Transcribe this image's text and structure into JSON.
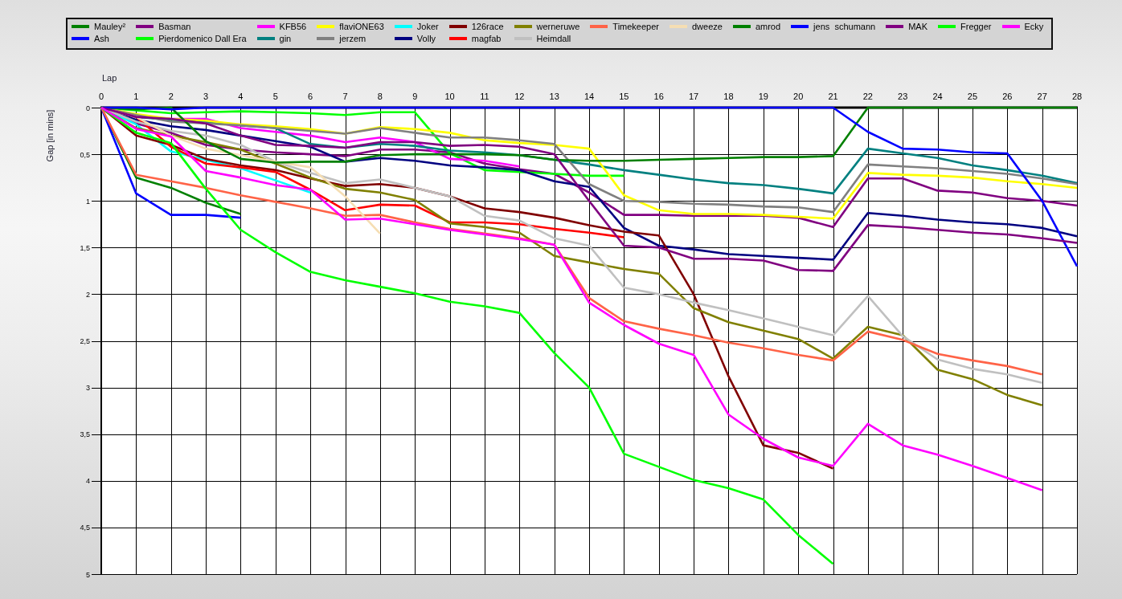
{
  "chart": {
    "chart_data": {
      "type": "line",
      "xlabel": "Lap",
      "ylabel": "Gap [in mins]",
      "grid": true,
      "x": [
        0,
        1,
        2,
        3,
        4,
        5,
        6,
        7,
        8,
        9,
        10,
        11,
        12,
        13,
        14,
        15,
        16,
        17,
        18,
        19,
        20,
        21,
        22,
        23,
        24,
        25,
        26,
        27,
        28
      ],
      "xlim": [
        0,
        28
      ],
      "ylim": [
        5,
        0
      ],
      "xticks": [
        0,
        1,
        2,
        3,
        4,
        5,
        6,
        7,
        8,
        9,
        10,
        11,
        12,
        13,
        14,
        15,
        16,
        17,
        18,
        19,
        20,
        21,
        22,
        23,
        24,
        25,
        26,
        27,
        28
      ],
      "yticks": [
        0,
        {
          "value": 0.5,
          "label": "0,5"
        },
        1,
        {
          "value": 1.5,
          "label": "1,5"
        },
        2,
        {
          "value": 2.5,
          "label": "2,5"
        },
        3,
        {
          "value": 3.5,
          "label": "3,5"
        },
        4,
        {
          "value": 4.5,
          "label": "4,5"
        },
        5
      ],
      "series": [
        {
          "name": "Mauley²",
          "color": "#008000",
          "values": [
            0,
            0.75,
            0.86,
            1.02,
            1.14,
            null,
            null,
            null,
            null,
            null,
            null,
            null,
            null,
            null,
            null,
            null,
            null,
            null,
            null,
            null,
            null,
            null,
            null,
            null,
            null,
            null,
            null,
            null,
            null
          ]
        },
        {
          "name": "Ash",
          "color": "#0000ff",
          "values": [
            0,
            0.92,
            1.15,
            1.15,
            1.18,
            null,
            null,
            null,
            null,
            null,
            null,
            null,
            null,
            null,
            null,
            null,
            null,
            null,
            null,
            null,
            null,
            null,
            null,
            null,
            null,
            null,
            null,
            null,
            null
          ]
        },
        {
          "name": "Basman",
          "color": "#800080",
          "values": [
            0,
            0.17,
            0.27,
            0.4,
            0.45,
            0.48,
            0.5,
            0.52,
            0.45,
            0.45,
            0.48,
            0.6,
            0.66,
            0.71,
            0.91,
            1.15,
            1.15,
            1.16,
            1.16,
            1.16,
            1.18,
            1.28,
            0.76,
            0.76,
            0.89,
            0.91,
            0.97,
            1.0,
            1.05
          ]
        },
        {
          "name": "Pierdomenico Dall Era",
          "color": "#00ff00",
          "values": [
            0,
            0.03,
            0.06,
            0.05,
            0.04,
            0.05,
            0.06,
            0.08,
            0.05,
            0.05,
            0.49,
            0.67,
            0.69,
            0.71,
            0.73,
            0.73,
            null,
            null,
            null,
            null,
            null,
            null,
            null,
            null,
            null,
            null,
            null,
            null,
            null
          ]
        },
        {
          "name": "KFB56",
          "color": "#ff00ff",
          "values": [
            0,
            0.1,
            0.12,
            0.12,
            0.22,
            0.26,
            0.3,
            0.37,
            0.32,
            0.37,
            0.55,
            0.57,
            0.63,
            null,
            null,
            null,
            null,
            null,
            null,
            null,
            null,
            null,
            null,
            null,
            null,
            null,
            null,
            null,
            null
          ]
        },
        {
          "name": "gin",
          "color": "#008080",
          "values": [
            0,
            0.1,
            0.13,
            0.15,
            0.19,
            0.22,
            0.39,
            0.43,
            0.39,
            0.41,
            0.46,
            0.48,
            0.51,
            0.56,
            0.61,
            0.67,
            0.72,
            0.77,
            0.81,
            0.83,
            0.87,
            0.92,
            0.44,
            0.49,
            0.54,
            0.62,
            0.67,
            0.73,
            0.81
          ]
        },
        {
          "name": "flaviONE63",
          "color": "#ffff00",
          "values": [
            0,
            0.07,
            0.12,
            0.14,
            0.18,
            0.2,
            0.23,
            0.28,
            0.21,
            0.23,
            0.27,
            0.35,
            0.38,
            0.4,
            0.44,
            0.94,
            1.1,
            1.14,
            1.14,
            1.15,
            1.17,
            1.19,
            0.7,
            0.72,
            0.73,
            0.75,
            0.79,
            0.82,
            0.86
          ]
        },
        {
          "name": "jerzem",
          "color": "#808080",
          "values": [
            0,
            0.08,
            0.15,
            0.17,
            0.19,
            0.22,
            0.25,
            0.28,
            0.22,
            0.27,
            0.32,
            0.32,
            0.35,
            0.39,
            0.82,
            1.0,
            1.01,
            1.03,
            1.04,
            1.06,
            1.07,
            1.12,
            0.61,
            0.63,
            0.65,
            0.68,
            0.71,
            0.76,
            0.82
          ]
        },
        {
          "name": "Joker",
          "color": "#00ffff",
          "values": [
            0,
            0.18,
            0.47,
            0.56,
            0.65,
            0.78,
            0.91,
            null,
            null,
            null,
            null,
            null,
            null,
            null,
            null,
            null,
            null,
            null,
            null,
            null,
            null,
            null,
            null,
            null,
            null,
            null,
            null,
            null,
            null
          ]
        },
        {
          "name": "Volly",
          "color": "#000080",
          "values": [
            0,
            0.13,
            0.2,
            0.24,
            0.3,
            0.36,
            0.42,
            0.58,
            0.54,
            0.57,
            0.62,
            0.64,
            0.67,
            0.79,
            0.85,
            1.29,
            1.48,
            1.52,
            1.57,
            1.59,
            1.61,
            1.63,
            1.13,
            1.16,
            1.2,
            1.23,
            1.25,
            1.29,
            1.38
          ]
        },
        {
          "name": "126race",
          "color": "#800000",
          "values": [
            0,
            0.3,
            0.4,
            0.55,
            0.62,
            0.67,
            0.76,
            0.84,
            0.82,
            0.86,
            0.95,
            1.08,
            1.12,
            1.18,
            1.26,
            1.33,
            1.37,
            2.0,
            2.88,
            3.62,
            3.7,
            3.87,
            null,
            null,
            null,
            null,
            null,
            null,
            null
          ]
        },
        {
          "name": "magfab",
          "color": "#ff0000",
          "values": [
            0,
            0.1,
            0.42,
            0.6,
            0.64,
            0.69,
            0.88,
            1.1,
            1.04,
            1.05,
            1.23,
            1.23,
            1.25,
            1.3,
            1.34,
            1.39,
            null,
            null,
            null,
            null,
            null,
            null,
            null,
            null,
            null,
            null,
            null,
            null,
            null
          ]
        },
        {
          "name": "werneruwe",
          "color": "#808000",
          "values": [
            0,
            0.22,
            0.3,
            0.37,
            0.45,
            0.6,
            0.75,
            0.87,
            0.91,
            0.99,
            1.24,
            1.28,
            1.34,
            1.59,
            1.66,
            1.73,
            1.78,
            2.15,
            2.3,
            2.39,
            2.48,
            2.69,
            2.35,
            2.44,
            2.81,
            2.91,
            3.08,
            3.19,
            null
          ]
        },
        {
          "name": "Heimdall",
          "color": "#c0c0c0",
          "values": [
            0,
            0.15,
            0.25,
            0.3,
            0.4,
            0.58,
            0.7,
            0.81,
            0.77,
            0.86,
            0.95,
            1.16,
            1.21,
            1.4,
            1.48,
            1.93,
            2.0,
            2.09,
            2.17,
            2.26,
            2.35,
            2.44,
            2.02,
            2.45,
            2.7,
            2.8,
            2.86,
            2.95,
            null
          ]
        },
        {
          "name": "Timekeeper",
          "color": "#ff6347",
          "values": [
            0,
            0.72,
            0.79,
            0.86,
            0.94,
            1.01,
            1.08,
            1.16,
            1.15,
            1.23,
            1.3,
            1.35,
            1.4,
            1.47,
            2.04,
            2.29,
            2.37,
            2.44,
            2.52,
            2.58,
            2.65,
            2.71,
            2.4,
            2.49,
            2.64,
            2.71,
            2.77,
            2.86,
            null
          ]
        },
        {
          "name": "dweeze",
          "color": "#f5deb3",
          "values": [
            0,
            0.1,
            0.3,
            0.44,
            0.51,
            0.58,
            0.64,
            0.95,
            1.35,
            null,
            null,
            null,
            null,
            null,
            null,
            null,
            null,
            null,
            null,
            null,
            null,
            null,
            null,
            null,
            null,
            null,
            null,
            null,
            null
          ]
        },
        {
          "name": "amrod",
          "color": "#008000",
          "values": [
            0,
            0.02,
            0,
            0.36,
            0.55,
            0.59,
            0.58,
            0.58,
            0.51,
            0.5,
            0.5,
            0.5,
            0.51,
            0.56,
            0.57,
            0.57,
            0.56,
            0.55,
            0.54,
            0.53,
            0.53,
            0.52,
            0,
            0,
            0,
            0,
            0,
            0,
            0
          ]
        },
        {
          "name": "jens  schumann",
          "color": "#0000ff",
          "values": [
            0,
            0,
            0.02,
            0,
            0,
            0,
            0,
            0,
            0,
            0,
            0,
            0,
            0,
            0,
            0,
            0,
            0,
            0,
            0,
            0,
            0,
            0,
            0.26,
            0.44,
            0.45,
            0.48,
            0.49,
            1.0,
            1.7
          ]
        },
        {
          "name": "MAK",
          "color": "#800080",
          "values": [
            0,
            0.1,
            0.12,
            0.17,
            0.3,
            0.4,
            0.41,
            0.43,
            0.37,
            0.37,
            0.41,
            0.4,
            0.42,
            0.5,
            1.0,
            1.48,
            1.5,
            1.62,
            1.62,
            1.64,
            1.74,
            1.75,
            1.26,
            1.28,
            1.31,
            1.34,
            1.36,
            1.4,
            1.45
          ]
        },
        {
          "name": "Fregger",
          "color": "#00ff00",
          "values": [
            0,
            0.27,
            0.38,
            0.87,
            1.31,
            1.55,
            1.76,
            1.85,
            1.92,
            1.99,
            2.08,
            2.13,
            2.2,
            2.63,
            3.0,
            3.71,
            3.85,
            3.99,
            4.08,
            4.2,
            4.58,
            4.89,
            null,
            null,
            null,
            null,
            null,
            null,
            null
          ]
        },
        {
          "name": "Ecky",
          "color": "#ff00ff",
          "values": [
            0,
            0.23,
            0.31,
            0.68,
            0.75,
            0.83,
            0.88,
            1.2,
            1.19,
            1.25,
            1.31,
            1.36,
            1.41,
            1.47,
            2.09,
            2.33,
            2.53,
            2.65,
            3.29,
            3.55,
            3.75,
            3.84,
            3.39,
            3.62,
            3.72,
            3.84,
            3.97,
            4.1,
            null
          ]
        }
      ]
    }
  }
}
